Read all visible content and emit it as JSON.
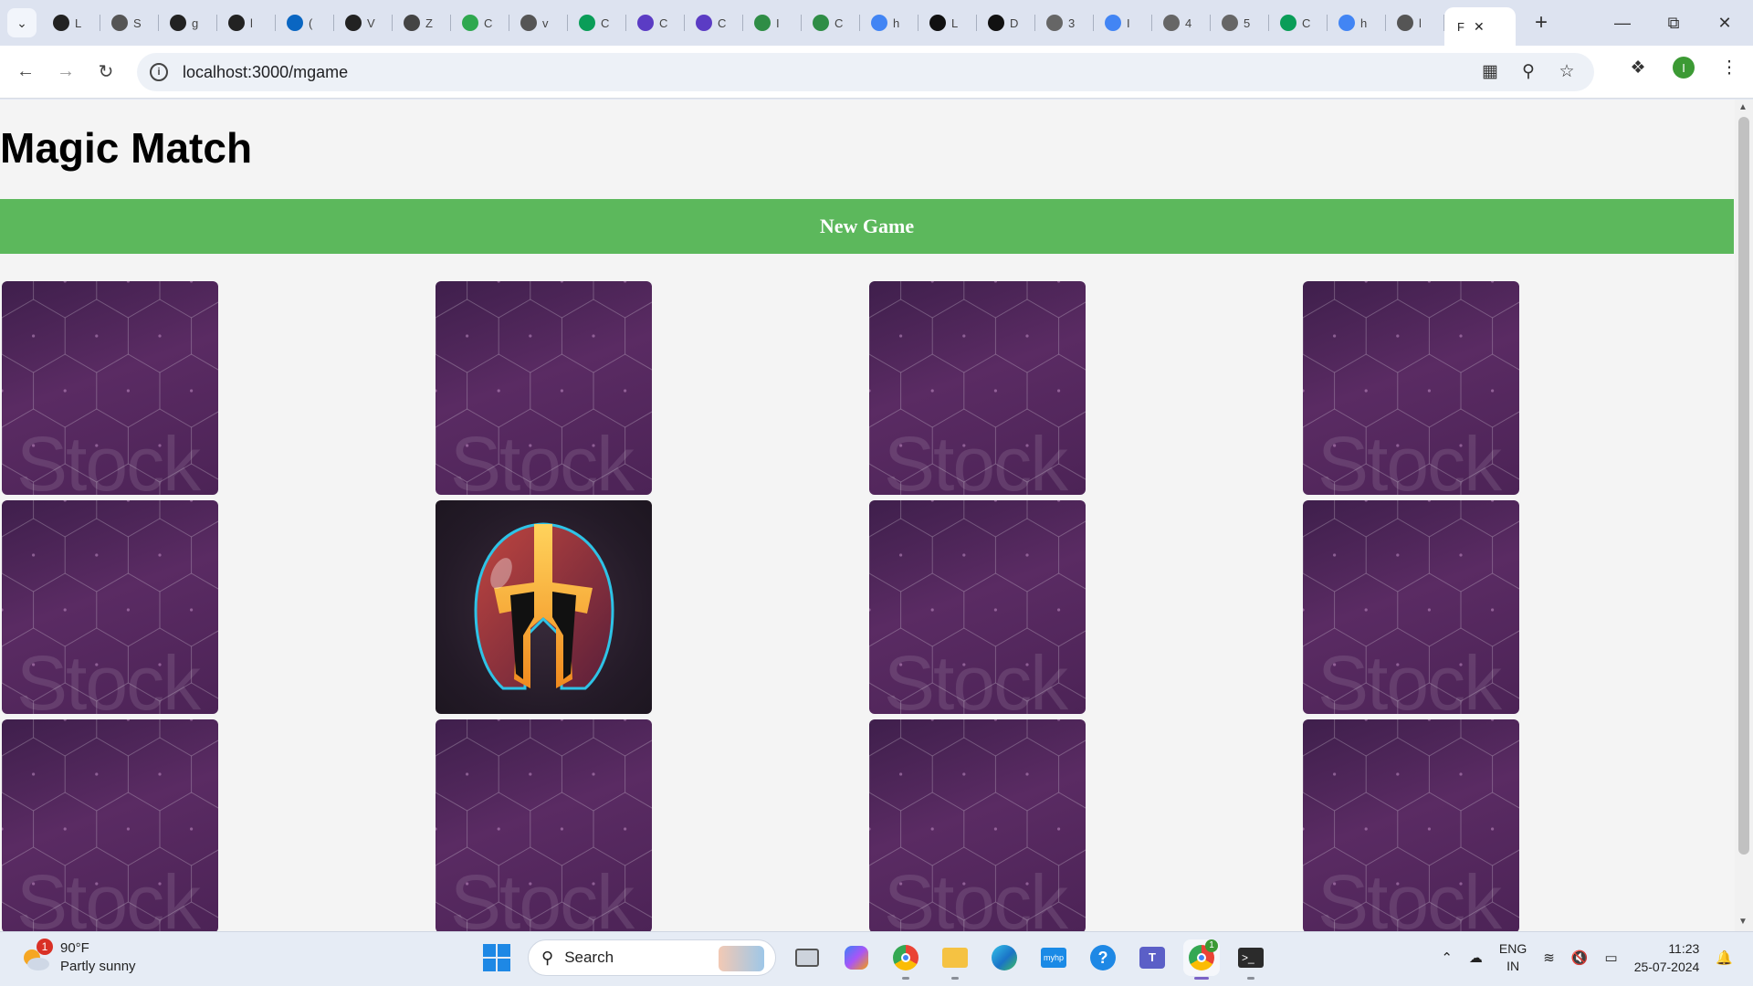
{
  "browser": {
    "tabs": [
      {
        "icon": "github-icon",
        "text": "L",
        "color": "#222"
      },
      {
        "icon": "globe-icon",
        "text": "S",
        "color": "#555"
      },
      {
        "icon": "github-icon",
        "text": "g",
        "color": "#222"
      },
      {
        "icon": "github-icon",
        "text": "l",
        "color": "#222"
      },
      {
        "icon": "linkedin-icon",
        "text": "(",
        "color": "#0a66c2"
      },
      {
        "icon": "github-icon",
        "text": "V",
        "color": "#222"
      },
      {
        "icon": "zigzag-icon",
        "text": "Z",
        "color": "#444"
      },
      {
        "icon": "leaf-icon",
        "text": "C",
        "color": "#2fa84f"
      },
      {
        "icon": "globe-icon",
        "text": "v",
        "color": "#555"
      },
      {
        "icon": "w-icon",
        "text": "C",
        "color": "#0a9d58"
      },
      {
        "icon": "p-icon",
        "text": "C",
        "color": "#5b3cc4"
      },
      {
        "icon": "p-icon",
        "text": "C",
        "color": "#5b3cc4"
      },
      {
        "icon": "gfg-icon",
        "text": "I",
        "color": "#2f8d46"
      },
      {
        "icon": "gfg-icon",
        "text": "C",
        "color": "#2f8d46"
      },
      {
        "icon": "google-icon",
        "text": "h",
        "color": "#4285f4"
      },
      {
        "icon": "h-icon",
        "text": "L",
        "color": "#111"
      },
      {
        "icon": "h-icon",
        "text": "D",
        "color": "#111"
      },
      {
        "icon": "w-circle-icon",
        "text": "3",
        "color": "#666"
      },
      {
        "icon": "google-icon",
        "text": "I",
        "color": "#4285f4"
      },
      {
        "icon": "w-circle-icon",
        "text": "4",
        "color": "#666"
      },
      {
        "icon": "w-circle-icon",
        "text": "5",
        "color": "#666"
      },
      {
        "icon": "w-icon",
        "text": "C",
        "color": "#0a9d58"
      },
      {
        "icon": "google-icon",
        "text": "h",
        "color": "#4285f4"
      },
      {
        "icon": "globe-icon",
        "text": "l",
        "color": "#555"
      }
    ],
    "active_tab": {
      "title": "F"
    },
    "url": "localhost:3000/mgame",
    "avatar_letter": "I"
  },
  "page": {
    "title": "Magic Match",
    "new_game_label": "New Game",
    "cards": [
      {
        "state": "back",
        "watermark": "Stock"
      },
      {
        "state": "back",
        "watermark": "Stock"
      },
      {
        "state": "back",
        "watermark": "Stock"
      },
      {
        "state": "back",
        "watermark": "Stock"
      },
      {
        "state": "back",
        "watermark": "Stock"
      },
      {
        "state": "front",
        "image": "knight-helmet"
      },
      {
        "state": "back",
        "watermark": "Stock"
      },
      {
        "state": "back",
        "watermark": "Stock"
      },
      {
        "state": "back",
        "watermark": "Stock"
      },
      {
        "state": "back",
        "watermark": "Stock"
      },
      {
        "state": "back",
        "watermark": "Stock"
      },
      {
        "state": "back",
        "watermark": "Stock"
      }
    ]
  },
  "taskbar": {
    "weather": {
      "badge": "1",
      "temp": "90°F",
      "desc": "Partly sunny"
    },
    "search_placeholder": "Search",
    "lang": {
      "line1": "ENG",
      "line2": "IN"
    },
    "clock": {
      "time": "11:23",
      "date": "25-07-2024"
    },
    "chrome_badge": "1"
  }
}
